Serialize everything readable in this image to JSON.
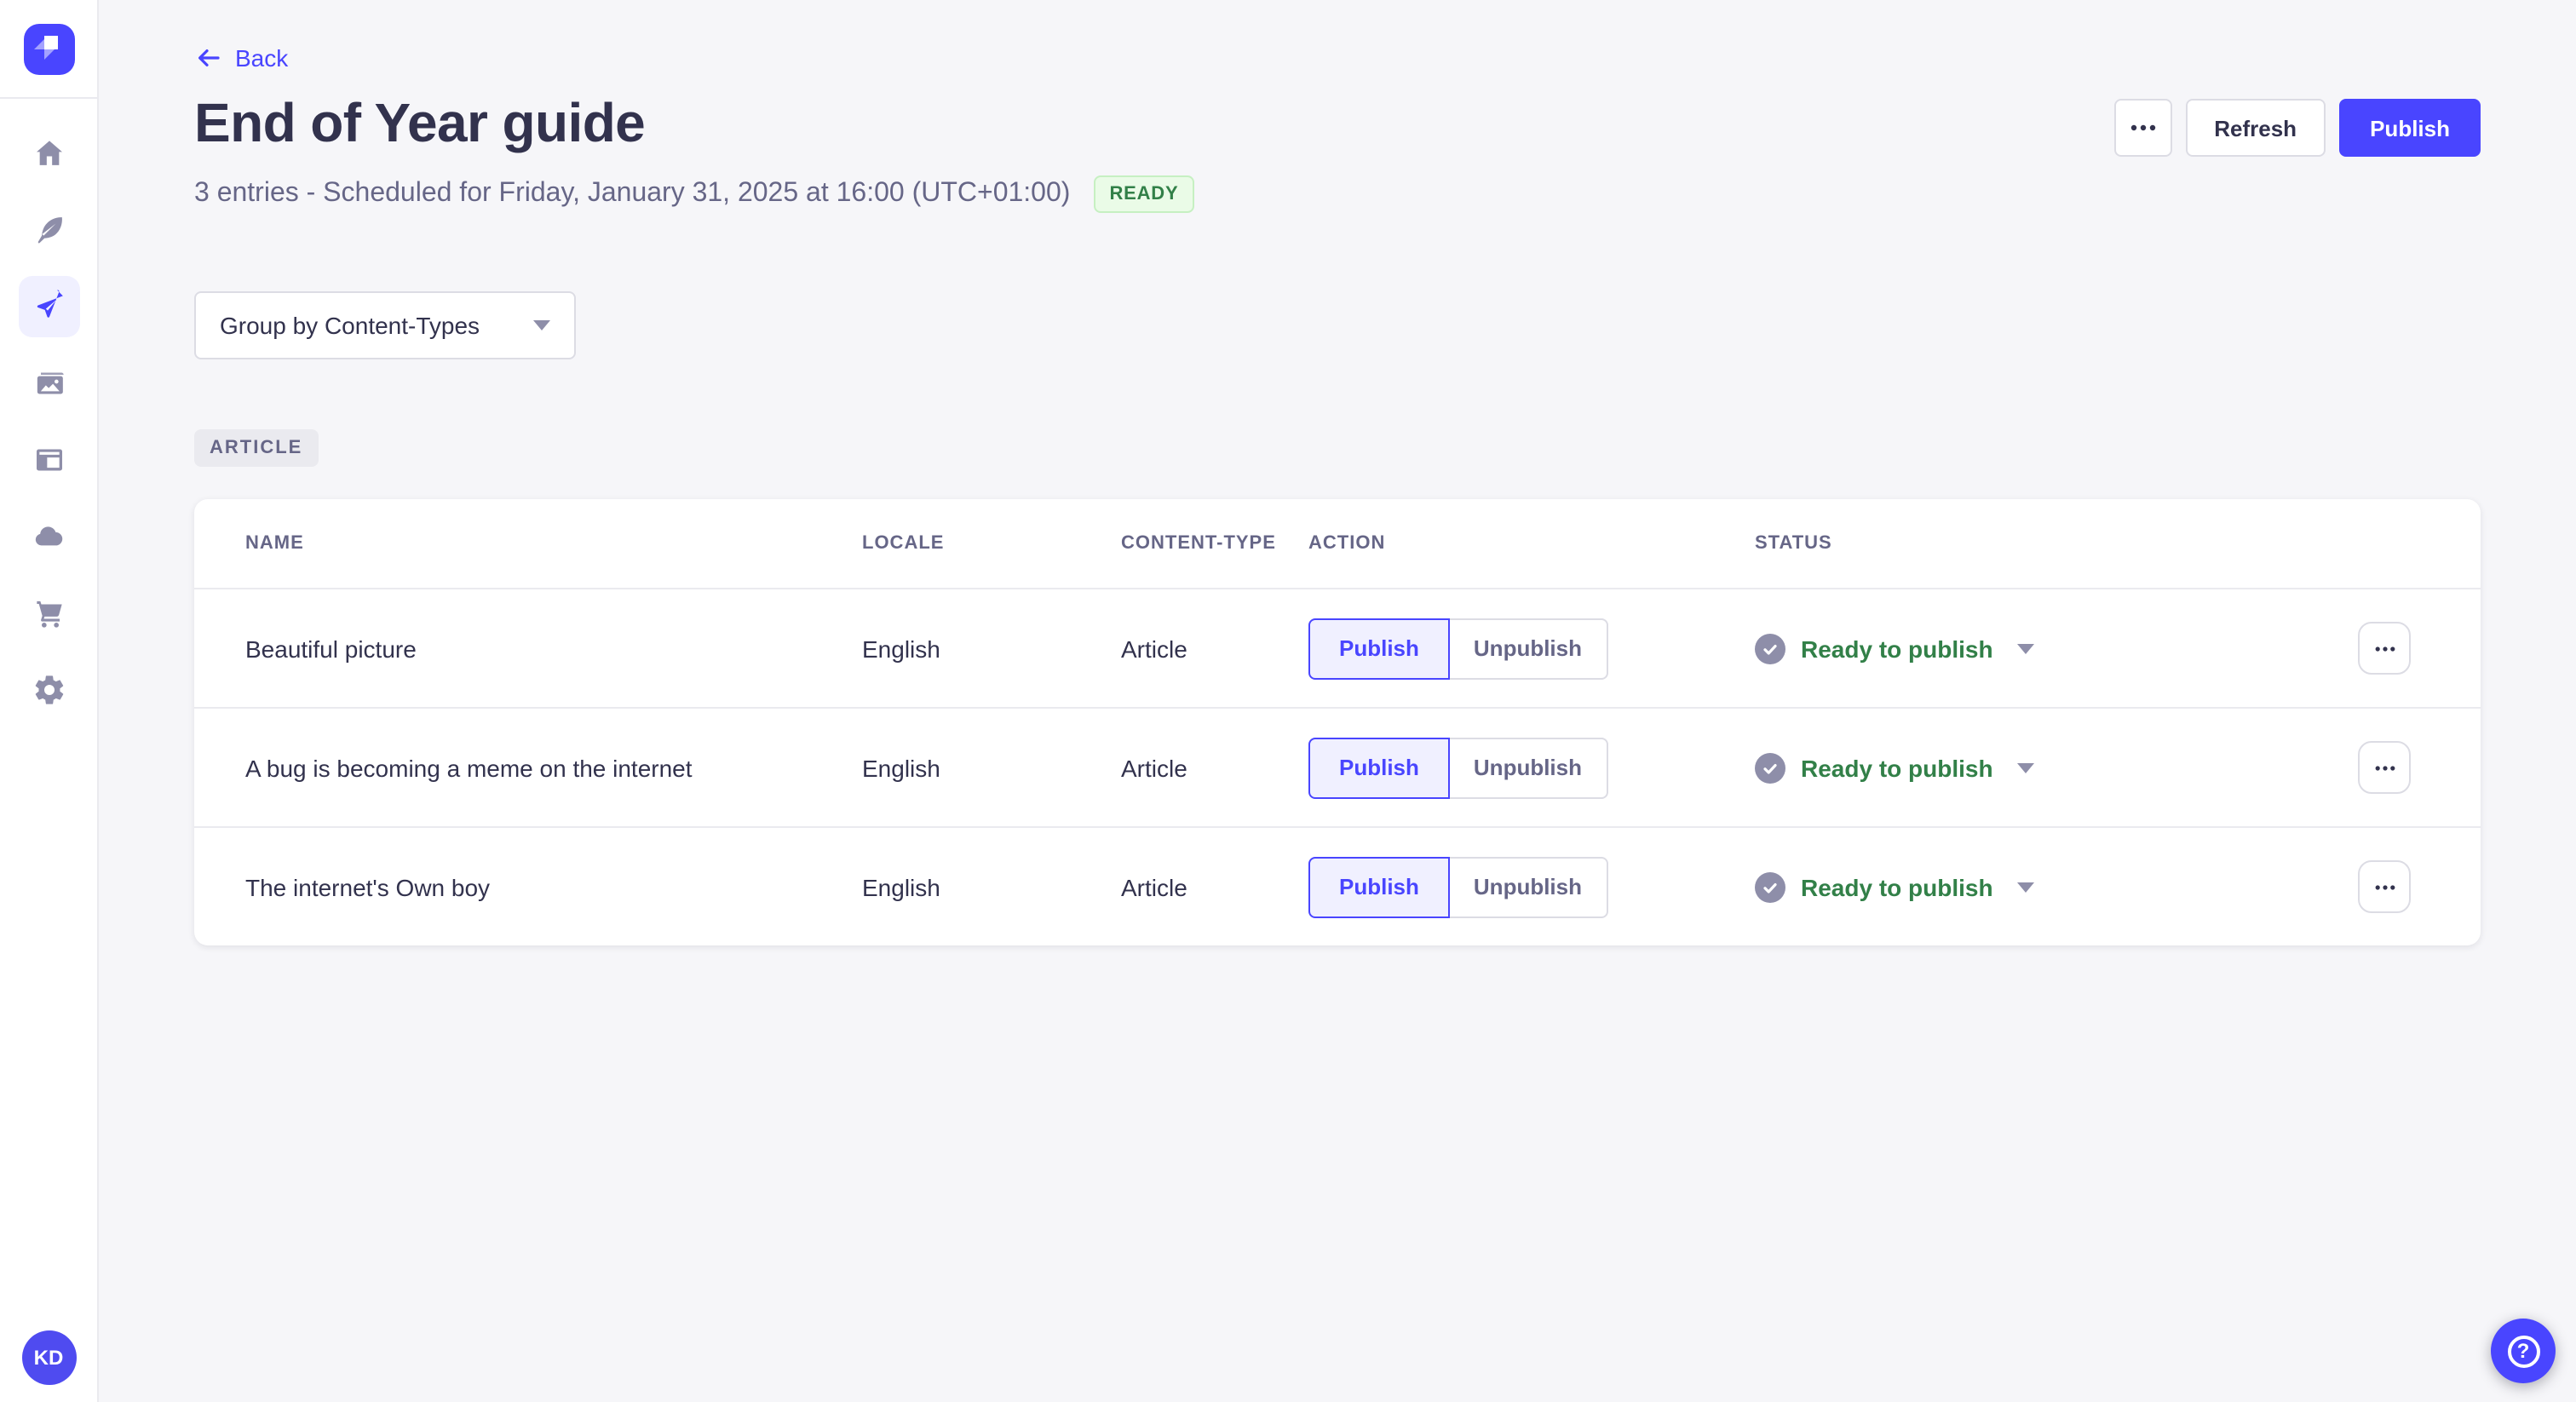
{
  "colors": {
    "primary": "#4945ff",
    "primary_light_bg": "#f0f0ff",
    "text_dark": "#32324d",
    "text_gray": "#666687",
    "icon_gray": "#8e8ea9",
    "border": "#dcdce4",
    "divider": "#eaeaef",
    "page_bg": "#f6f6f9",
    "success_text": "#328048",
    "success_bg": "#eafbe7",
    "success_border": "#c6f0c2"
  },
  "sidebar": {
    "logo_icon": "strapi-logo",
    "items": [
      {
        "id": "home",
        "icon": "home-icon",
        "active": false
      },
      {
        "id": "content-manager",
        "icon": "feather-icon",
        "active": false
      },
      {
        "id": "releases",
        "icon": "paper-plane-icon",
        "active": true
      },
      {
        "id": "media-library",
        "icon": "images-icon",
        "active": false
      },
      {
        "id": "content-type-builder",
        "icon": "layout-icon",
        "active": false
      },
      {
        "id": "cloud",
        "icon": "cloud-icon",
        "active": false
      },
      {
        "id": "marketplace",
        "icon": "cart-icon",
        "active": false
      },
      {
        "id": "settings",
        "icon": "gear-icon",
        "active": false
      }
    ],
    "avatar_initials": "KD"
  },
  "header": {
    "back_label": "Back",
    "title": "End of Year guide",
    "subtitle": "3 entries - Scheduled for Friday, January 31, 2025 at 16:00 (UTC+01:00)",
    "status_badge": "READY",
    "refresh_label": "Refresh",
    "publish_label": "Publish"
  },
  "toolbar": {
    "group_by_label": "Group by Content-Types"
  },
  "content": {
    "group_badge": "ARTICLE",
    "table": {
      "columns": [
        "NAME",
        "LOCALE",
        "CONTENT-TYPE",
        "ACTION",
        "STATUS"
      ],
      "action_labels": {
        "publish": "Publish",
        "unpublish": "Unpublish"
      },
      "rows": [
        {
          "name": "Beautiful picture",
          "locale": "English",
          "content_type": "Article",
          "status": "Ready to publish"
        },
        {
          "name": "A bug is becoming a meme on the internet",
          "locale": "English",
          "content_type": "Article",
          "status": "Ready to publish"
        },
        {
          "name": "The internet's Own boy",
          "locale": "English",
          "content_type": "Article",
          "status": "Ready to publish"
        }
      ]
    }
  },
  "fab": {
    "help_label": "?"
  }
}
